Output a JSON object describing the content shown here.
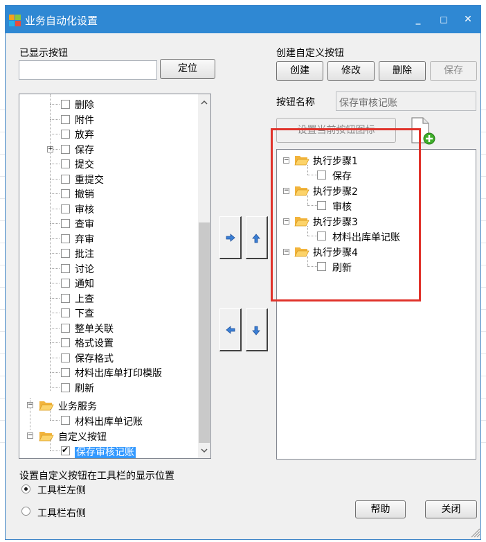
{
  "window": {
    "title": "业务自动化设置",
    "controls": {
      "minimize": "_",
      "maximize": "□",
      "close": "✕"
    }
  },
  "left": {
    "shown_buttons_label": "已显示按钮",
    "search_value": "",
    "locate_button": "定位",
    "tree": [
      {
        "label": "删除"
      },
      {
        "label": "附件"
      },
      {
        "label": "放弃"
      },
      {
        "label": "保存"
      },
      {
        "label": "提交"
      },
      {
        "label": "重提交"
      },
      {
        "label": "撤销"
      },
      {
        "label": "审核"
      },
      {
        "label": "查审"
      },
      {
        "label": "弃审"
      },
      {
        "label": "批注"
      },
      {
        "label": "讨论"
      },
      {
        "label": "通知"
      },
      {
        "label": "上查"
      },
      {
        "label": "下查"
      },
      {
        "label": "整单关联"
      },
      {
        "label": "格式设置"
      },
      {
        "label": "保存格式"
      },
      {
        "label": "材料出库单打印模版"
      },
      {
        "label": "刷新"
      }
    ],
    "group_business": "业务服务",
    "group_business_child": "材料出库单记账",
    "group_custom": "自定义按钮",
    "group_custom_child": "保存审核记账",
    "position_label": "设置自定义按钮在工具栏的显示位置",
    "radio_left": "工具栏左侧",
    "radio_right": "工具栏右侧",
    "radio_selected": "工具栏左侧"
  },
  "right": {
    "create_custom_label": "创建自定义按钮",
    "buttons": {
      "create": "创建",
      "modify": "修改",
      "delete": "删除",
      "save": "保存"
    },
    "button_name_label": "按钮名称",
    "button_name_value": "保存审核记账",
    "set_icon_button": "设置当前按钮图标",
    "steps": [
      {
        "label": "执行步骤1",
        "child": "保存"
      },
      {
        "label": "执行步骤2",
        "child": "审核"
      },
      {
        "label": "执行步骤3",
        "child": "材料出库单记账"
      },
      {
        "label": "执行步骤4",
        "child": "刷新"
      }
    ],
    "help_button": "帮助",
    "close_button": "关闭"
  },
  "colors": {
    "titlebar": "#2f88d3",
    "selection": "#3399ff",
    "highlight_box": "#e0322a"
  }
}
